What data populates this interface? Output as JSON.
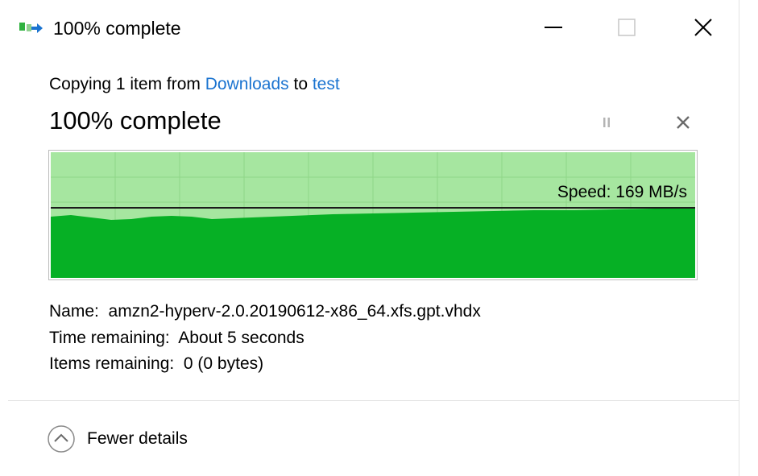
{
  "window": {
    "title": "100% complete",
    "minimize_symbol": "—",
    "maximize_symbol": "☐",
    "close_symbol": "✕"
  },
  "operation": {
    "prefix": "Copying 1 item from ",
    "source": "Downloads",
    "middle": " to ",
    "destination": "test"
  },
  "progress": {
    "heading": "100% complete",
    "percent": 100,
    "pause_symbol": "⏸",
    "cancel_symbol": "✕"
  },
  "graph": {
    "speed_label": "Speed: 169 MB/s",
    "speed_line_fraction": 0.56,
    "fill_color": "#06b025",
    "background_color": "#a6e6a0",
    "grid_color": "#8fd687"
  },
  "details": {
    "name_label": "Name:",
    "name_value": "amzn2-hyperv-2.0.20190612-x86_64.xfs.gpt.vhdx",
    "time_label": "Time remaining:",
    "time_value": "About 5 seconds",
    "items_label": "Items remaining:",
    "items_value": "0 (0 bytes)"
  },
  "footer": {
    "fewer_details_label": "Fewer details"
  },
  "icons": {
    "app": "file-copy-icon",
    "fewer": "chevron-up-circle-icon"
  },
  "colors": {
    "link": "#1a73d0",
    "progress_green": "#06b025"
  }
}
